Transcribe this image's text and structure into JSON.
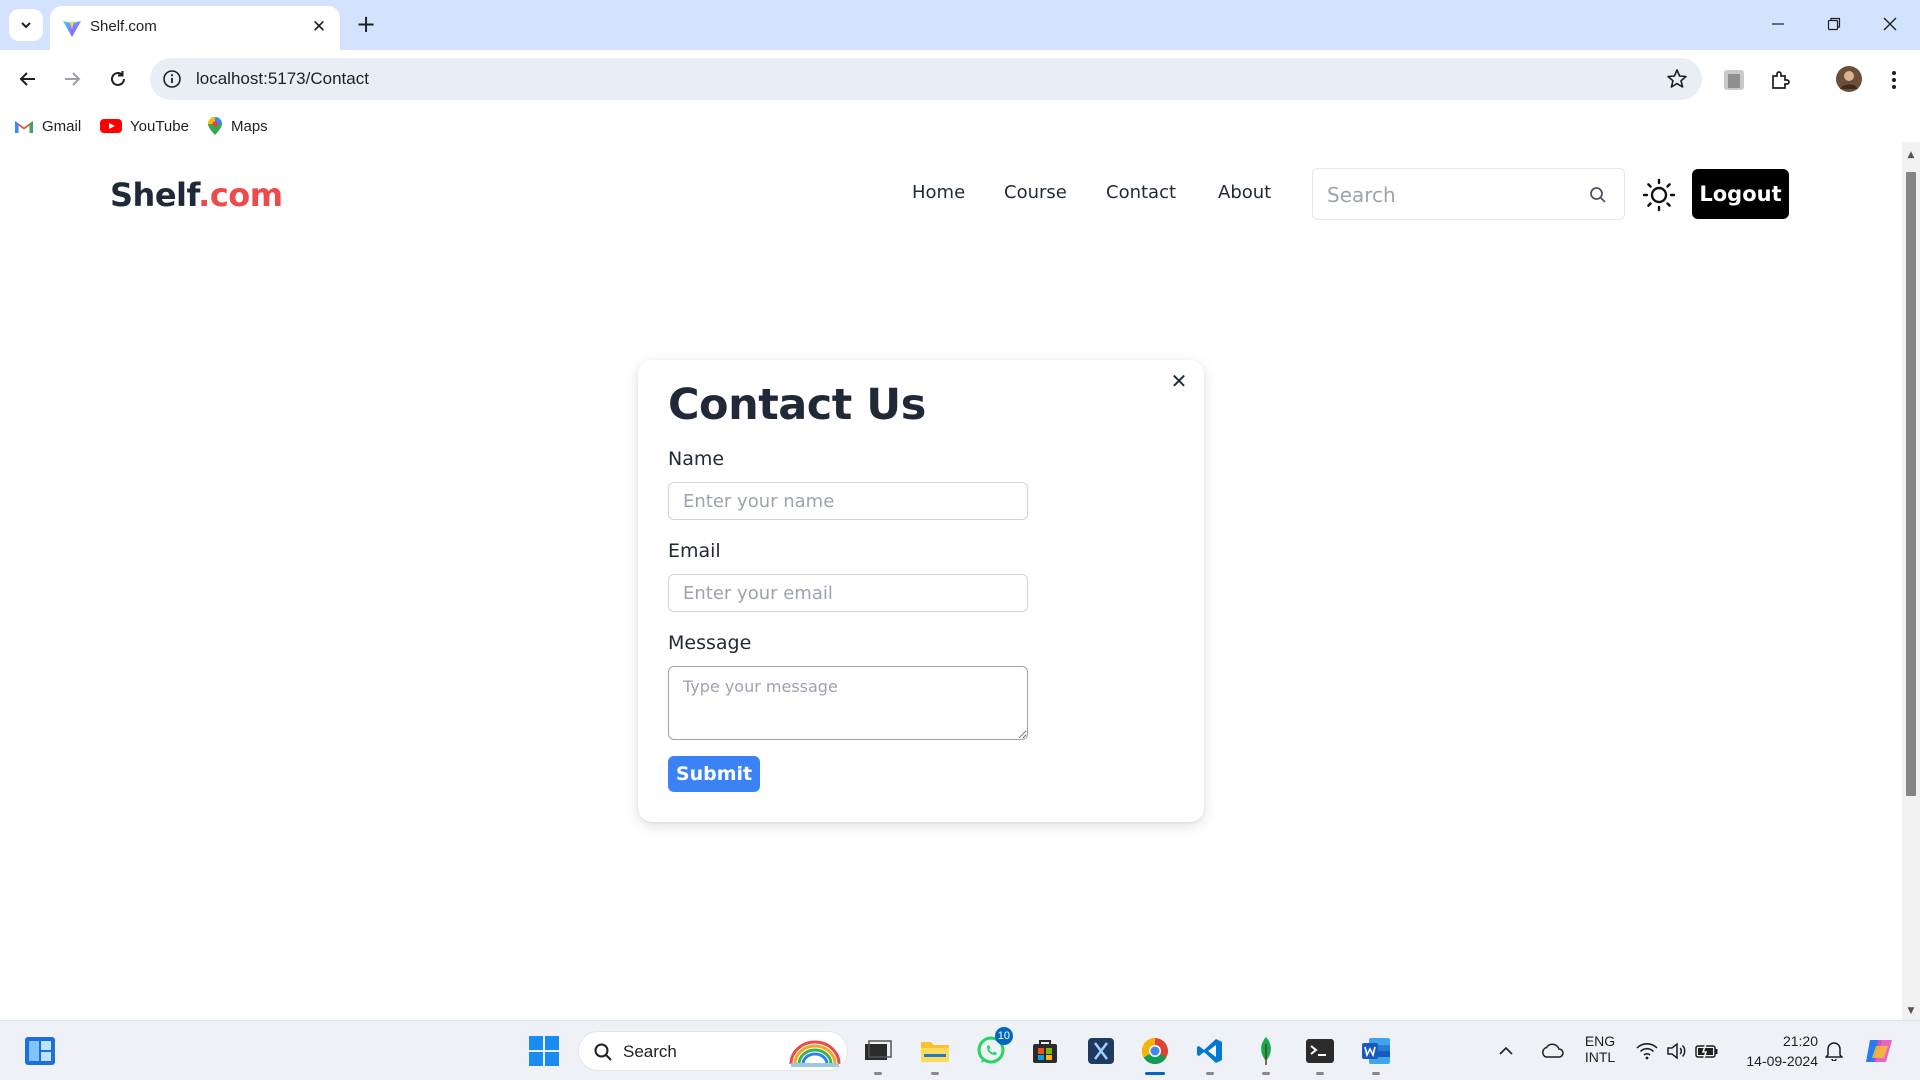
{
  "browser": {
    "tab_title": "Shelf.com",
    "url": "localhost:5173/Contact",
    "bookmarks": [
      {
        "label": "Gmail",
        "icon": "gmail-icon"
      },
      {
        "label": "YouTube",
        "icon": "youtube-icon"
      },
      {
        "label": "Maps",
        "icon": "maps-icon"
      }
    ]
  },
  "site": {
    "logo_main": "Shelf",
    "logo_accent": ".com",
    "nav": [
      "Home",
      "Course",
      "Contact",
      "About"
    ],
    "search_placeholder": "Search",
    "logout_label": "Logout"
  },
  "contact_form": {
    "title": "Contact Us",
    "name_label": "Name",
    "name_placeholder": "Enter your name",
    "email_label": "Email",
    "email_placeholder": "Enter your email",
    "message_label": "Message",
    "message_placeholder": "Type your message",
    "submit_label": "Submit",
    "close_glyph": "✕"
  },
  "taskbar": {
    "search_label": "Search",
    "whatsapp_badge": "10",
    "lang_line1": "ENG",
    "lang_line2": "INTL",
    "time": "21:20",
    "date": "14-09-2024"
  },
  "colors": {
    "accent_red": "#ec4b4b",
    "submit_blue": "#3b82f6",
    "logout_bg": "#000000",
    "tabbar_bg": "#d3e3fd"
  }
}
